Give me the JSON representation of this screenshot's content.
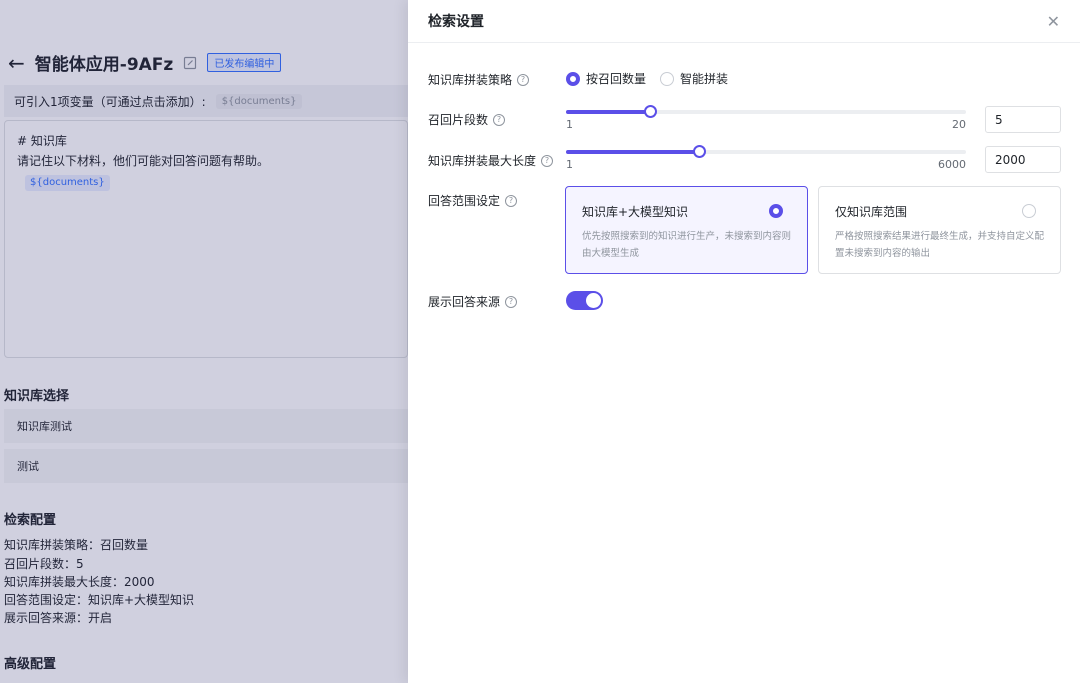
{
  "background": {
    "app_title": "智能体应用-9AFz",
    "status_badge": "已发布编辑中",
    "variables_hint": "可引入1项变量（可通过点击添加）:",
    "variable_chip": "${documents}",
    "prompt_line1": "# 知识库",
    "prompt_line2": "请记住以下材料，他们可能对回答问题有帮助。",
    "prompt_chip": "${documents}",
    "kb_section_title": "知识库选择",
    "kb_items": [
      "知识库测试",
      "测试"
    ],
    "retrieval_section_title": "检索配置",
    "retrieval_summary": [
      "知识库拼装策略：召回数量",
      "召回片段数：5",
      "知识库拼装最大长度：2000",
      "回答范围设定：知识库+大模型知识",
      "展示回答来源：开启"
    ],
    "advanced_section_title": "高级配置"
  },
  "drawer": {
    "title": "检索设置",
    "assembly_strategy": {
      "label": "知识库拼装策略",
      "options": [
        "按召回数量",
        "智能拼装"
      ],
      "selected_index": 0
    },
    "recall_segments": {
      "label": "召回片段数",
      "min": "1",
      "max": "20",
      "value": "5",
      "fraction": 0.2105
    },
    "max_length": {
      "label": "知识库拼装最大长度",
      "min": "1",
      "max": "6000",
      "value": "2000",
      "fraction": 0.3332
    },
    "answer_scope": {
      "label": "回答范围设定",
      "options": [
        {
          "title": "知识库+大模型知识",
          "desc": "优先按照搜索到的知识进行生产，未搜索到内容则由大模型生成",
          "selected": true
        },
        {
          "title": "仅知识库范围",
          "desc": "严格按照搜索结果进行最终生成，并支持自定义配置未搜索到内容的输出",
          "selected": false
        }
      ]
    },
    "show_source": {
      "label": "展示回答来源",
      "on": true
    }
  },
  "colors": {
    "accent": "#5b4fe8",
    "selected_card_bg": "#f5f4ff"
  }
}
